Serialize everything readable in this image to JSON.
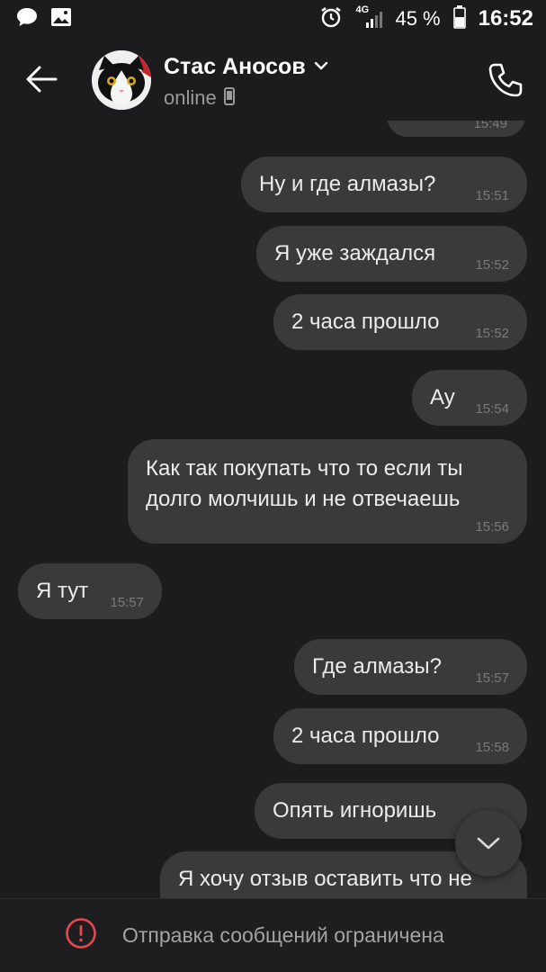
{
  "status_bar": {
    "network": "4G",
    "battery_percent": "45 %",
    "time": "16:52"
  },
  "header": {
    "contact_name": "Стас Аносов",
    "presence": "online"
  },
  "messages": [
    {
      "text": "",
      "time": "15:49",
      "outgoing": true
    },
    {
      "text": "Ну и где алмазы?",
      "time": "15:51",
      "outgoing": true
    },
    {
      "text": "Я уже заждался",
      "time": "15:52",
      "outgoing": true
    },
    {
      "text": "2 часа прошло",
      "time": "15:52",
      "outgoing": true
    },
    {
      "text": "Ау",
      "time": "15:54",
      "outgoing": true
    },
    {
      "text": "Как так покупать что то если ты\nдолго молчишь и не отвечаешь",
      "time": "15:56",
      "outgoing": true
    },
    {
      "text": "Я тут",
      "time": "15:57",
      "outgoing": false
    },
    {
      "text": "Где алмазы?",
      "time": "15:57",
      "outgoing": true
    },
    {
      "text": "2 часа прошло",
      "time": "15:58",
      "outgoing": true
    },
    {
      "text": "Опять игноришь",
      "time": "",
      "outgoing": true
    },
    {
      "text": "Я хочу отзыв оставить что не",
      "time": "",
      "outgoing": true
    }
  ],
  "footer": {
    "restriction_text": "Отправка сообщений ограничена"
  },
  "colors": {
    "background": "#1c1c1e",
    "bubble": "#3a3a3c",
    "warning": "#e5484d"
  }
}
